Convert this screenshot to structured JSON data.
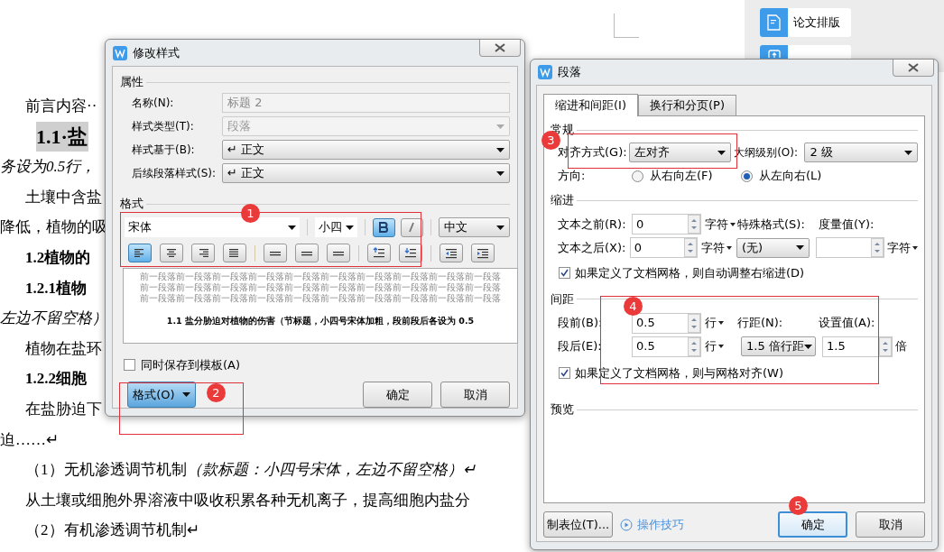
{
  "document": {
    "lines": [
      {
        "kind": "body",
        "text": "前言内容··"
      },
      {
        "kind": "heading",
        "text": "1.1·盐"
      },
      {
        "kind": "italic",
        "text": "务设为0.5行，"
      },
      {
        "kind": "body",
        "text": "土壤中含盐"
      },
      {
        "kind": "plain",
        "text": "降低，植物的吸"
      },
      {
        "kind": "bold",
        "text": "1.2植物的"
      },
      {
        "kind": "bold",
        "text": "1.2.1植物"
      },
      {
        "kind": "italic",
        "text": "左边不留空格）"
      },
      {
        "kind": "body",
        "text": "植物在盐环"
      },
      {
        "kind": "bold",
        "text": "1.2.2细胞"
      },
      {
        "kind": "body",
        "text": "在盐胁迫下"
      },
      {
        "kind": "plain",
        "text": "迫……↵"
      },
      {
        "kind": "body",
        "text": "（1）无机渗透调节机制",
        "note": "（款标题：小四号宋体，左边不留空格）↵"
      },
      {
        "kind": "body",
        "text": "从土壤或细胞外界溶液中吸收积累各种无机离子，提高细胞内盐分"
      },
      {
        "kind": "body",
        "text": "（2）有机渗透调节机制↵"
      }
    ]
  },
  "side_panel": {
    "items": [
      {
        "kind": "layout",
        "label": "论文排版"
      },
      {
        "kind": "merge"
      }
    ]
  },
  "style_dialog": {
    "title": "修改样式",
    "properties": {
      "legend": "属性",
      "fields": [
        {
          "label": "名称(N):",
          "value": "标题 2",
          "kind": "text",
          "disabled": true
        },
        {
          "label": "样式类型(T):",
          "value": "段落",
          "kind": "select",
          "disabled": true
        },
        {
          "label": "样式基于(B):",
          "value": "↵ 正文",
          "kind": "select",
          "disabled": false
        },
        {
          "label": "后续段落样式(S):",
          "value": "↵ 正文",
          "kind": "select",
          "disabled": false
        }
      ]
    },
    "format": {
      "legend": "格式",
      "font": "宋体",
      "size": "小四",
      "bold": true,
      "italic": false,
      "script": "中文",
      "align_buttons": [
        {
          "kind": "left",
          "selected": true
        },
        {
          "kind": "center",
          "selected": false
        },
        {
          "kind": "right",
          "selected": false
        },
        {
          "kind": "justify",
          "selected": false
        }
      ],
      "preview": {
        "filler": [
          "前一段落前一段落前一段落前一段落前一段落前一段落前一段落前一段落前一段落前一段落",
          "前一段落前一段落前一段落前一段落前一段落前一段落前一段落前一段落前一段落前一段落",
          "前一段落前一段落前一段落前一段落前一段落前一段落前一段落前一段落前一段落前一段落"
        ],
        "sample": "1.1  盐分胁迫对植物的伤害（节标题，小四号宋体加粗，段前段后各设为 0.5"
      }
    },
    "save_to_template": {
      "label": "同时保存到模板(A)",
      "checked": false
    },
    "buttons": {
      "format": "格式(O)",
      "ok": "确定",
      "cancel": "取消"
    }
  },
  "paragraph_dialog": {
    "title": "段落",
    "tabs": [
      {
        "label": "缩进和间距(I)",
        "selected": true
      },
      {
        "label": "换行和分页(P)",
        "selected": false
      }
    ],
    "general": {
      "legend": "常规",
      "alignment_label": "对齐方式(G):",
      "alignment": "左对齐",
      "outline_label": "大纲级别(O):",
      "outline": "2 级",
      "direction_label": "方向:",
      "directions": [
        {
          "label": "从右向左(F)",
          "selected": false
        },
        {
          "label": "从左向右(L)",
          "selected": true
        }
      ]
    },
    "indent": {
      "legend": "缩进",
      "before_label": "文本之前(R):",
      "before": "0",
      "before_unit": "字符",
      "after_label": "文本之后(X):",
      "after": "0",
      "after_unit": "字符",
      "special_label": "特殊格式(S):",
      "special": "(无)",
      "measure_label": "度量值(Y):",
      "measure_unit": "字符",
      "auto_adjust": {
        "label": "如果定义了文档网格，则自动调整右缩进(D)",
        "checked": true
      }
    },
    "spacing": {
      "legend": "间距",
      "before_label": "段前(B):",
      "before": "0.5",
      "before_unit": "行",
      "after_label": "段后(E):",
      "after": "0.5",
      "after_unit": "行",
      "line_label": "行距(N):",
      "line": "1.5 倍行距",
      "value_label": "设置值(A):",
      "value": "1.5",
      "value_unit": "倍",
      "snap_grid": {
        "label": "如果定义了文档网格，则与网格对齐(W)",
        "checked": true
      }
    },
    "preview_legend": "预览",
    "tabs_button": "制表位(T)...",
    "tips_link": "操作技巧",
    "ok": "确定",
    "cancel": "取消"
  },
  "annotations": [
    {
      "label": "1"
    },
    {
      "label": "2"
    },
    {
      "label": "3"
    },
    {
      "label": "4"
    },
    {
      "label": "5"
    }
  ]
}
